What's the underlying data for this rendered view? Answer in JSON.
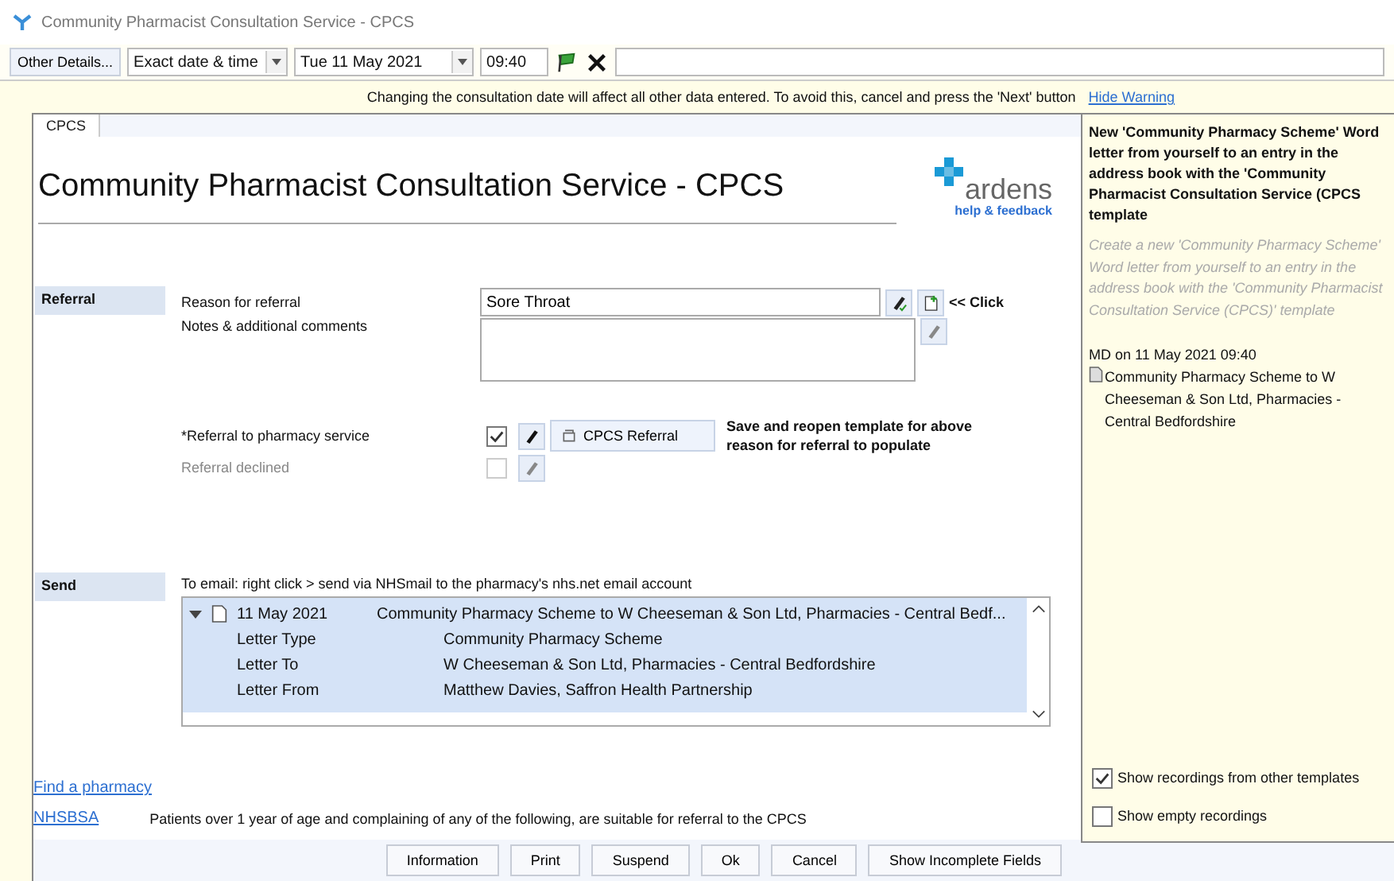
{
  "window": {
    "title": "Community Pharmacist Consultation Service - CPCS"
  },
  "toolbar": {
    "other_details": "Other Details...",
    "date_mode": "Exact date & time",
    "date": "Tue 11 May 2021",
    "time": "09:40"
  },
  "warning": {
    "text": "Changing the consultation date will affect all other data entered. To avoid this, cancel and press the 'Next' button",
    "link": "Hide Warning"
  },
  "tabs": [
    {
      "label": "CPCS",
      "selected": true
    }
  ],
  "form": {
    "title": "Community Pharmacist Consultation Service - CPCS",
    "logo": {
      "name": "ardens",
      "subtitle": "help & feedback"
    },
    "referral": {
      "heading": "Referral",
      "reason_label": "Reason for referral",
      "reason_value": "Sore Throat",
      "click_note": "<< Click",
      "notes_label": "Notes & additional comments",
      "options": [
        {
          "label": "*Referral to pharmacy service",
          "checked": true,
          "disabled": false,
          "template": "CPCS Referral",
          "note": "Save and reopen template for above reason for referral to populate"
        },
        {
          "label": "Referral declined",
          "checked": false,
          "disabled": true
        }
      ]
    },
    "send": {
      "heading": "Send",
      "instruction": "To email: right click > send via NHSmail to the pharmacy's nhs.net email account",
      "letter": {
        "expanded": true,
        "date": "11 May 2021",
        "summary": "Community Pharmacy Scheme to W Cheeseman & Son Ltd, Pharmacies - Central Bedf...",
        "details": [
          {
            "label": "Letter Type",
            "value": "Community Pharmacy Scheme"
          },
          {
            "label": "Letter To",
            "value": "W Cheeseman & Son Ltd, Pharmacies - Central Bedfordshire"
          },
          {
            "label": "Letter From",
            "value": "Matthew Davies, Saffron Health Partnership"
          }
        ]
      }
    },
    "links": [
      {
        "label": "Find a pharmacy"
      },
      {
        "label": "NHSBSA",
        "note": "Patients over 1 year of age and complaining of any of the following, are suitable for referral to the CPCS"
      }
    ]
  },
  "buttons": [
    "Information",
    "Print",
    "Suspend",
    "Ok",
    "Cancel",
    "Show Incomplete Fields"
  ],
  "side_panel": {
    "heading": "New 'Community Pharmacy Scheme' Word letter from yourself to an entry in the address book with the 'Community Pharmacist Consultation Service (CPCS template",
    "description": "Create a new 'Community Pharmacy Scheme' Word letter from yourself to an entry in the address book with the 'Community Pharmacist Consultation Service (CPCS)' template",
    "entry": {
      "meta": "MD on 11 May 2021 09:40",
      "text": "Community Pharmacy Scheme to W Cheeseman & Son Ltd, Pharmacies - Central Bedfordshire"
    },
    "options": [
      {
        "label": "Show recordings from other templates",
        "checked": true
      },
      {
        "label": "Show empty recordings",
        "checked": false
      }
    ]
  }
}
